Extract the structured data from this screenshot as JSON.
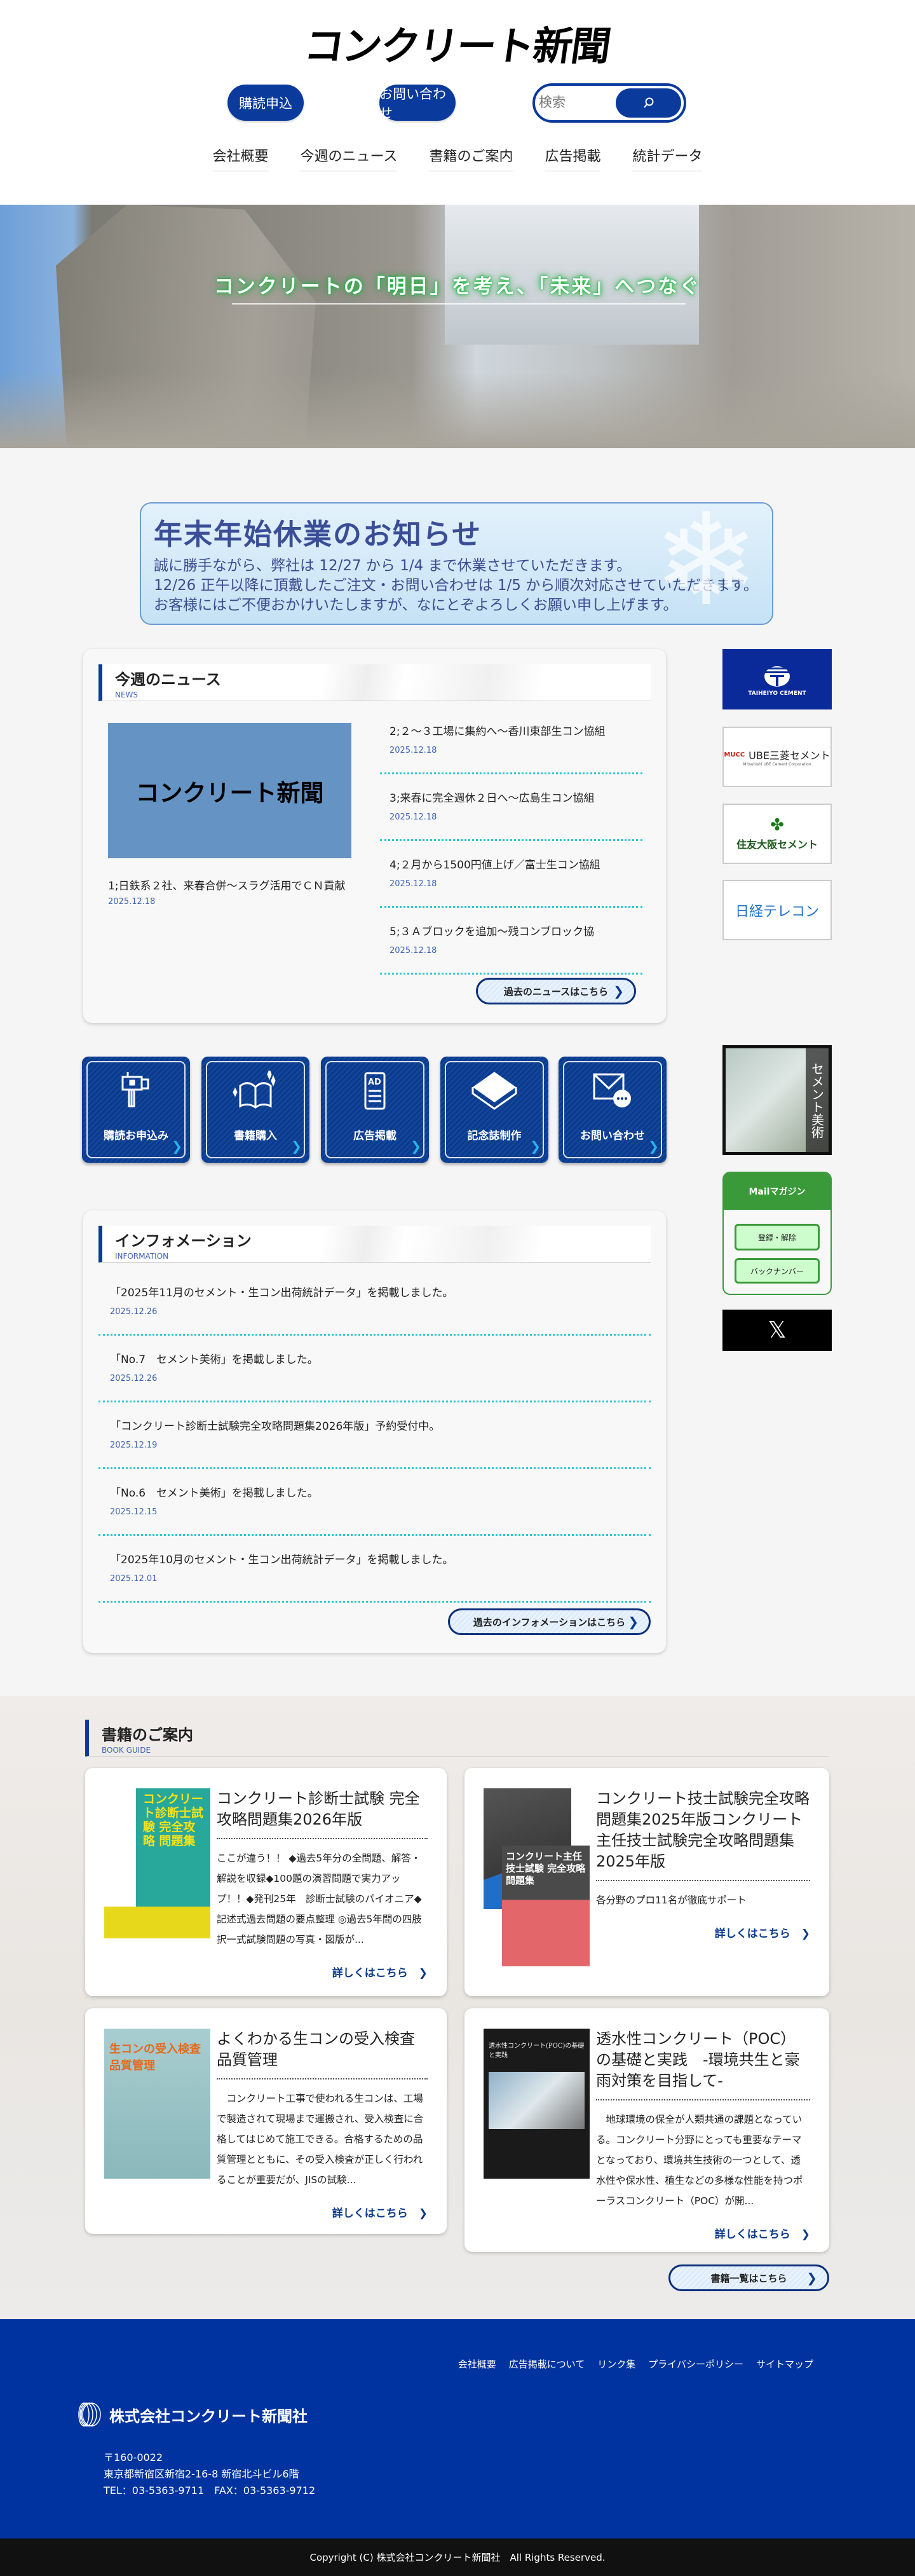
{
  "header": {
    "logo_text": "コンクリート新聞",
    "subscribe_label": "購読申込",
    "contact_label": "お問い合わせ",
    "search_placeholder": "検索",
    "nav": [
      "会社概要",
      "今週のニュース",
      "書籍のご案内",
      "広告掲載",
      "統計データ"
    ]
  },
  "hero": {
    "slogan": "コンクリートの「明日」を考え、「未来」へつなぐ"
  },
  "notice": {
    "title": "年末年始休業のお知らせ",
    "lines": [
      "誠に勝手ながら、弊社は 12/27 から 1/4 まで休業させていただきます。",
      "12/26 正午以降に頂戴したご注文・お問い合わせは 1/5 から順次対応させていただきます。",
      "お客様にはご不便おかけいたしますが、なにとぞよろしくお願い申し上げます。"
    ]
  },
  "news": {
    "title": "今週のニュース",
    "subtitle": "NEWS",
    "image_text": "コンクリート新聞",
    "featured": {
      "title": "1;日鉄系２社、来春合併～スラグ活用でＣＮ貢献",
      "date": "2025.12.18"
    },
    "items": [
      {
        "title": "2;２～３工場に集約へ～香川東部生コン協組",
        "date": "2025.12.18"
      },
      {
        "title": "3;来春に完全週休２日へ～広島生コン協組",
        "date": "2025.12.18"
      },
      {
        "title": "4;２月から1500円値上げ／富士生コン協組",
        "date": "2025.12.18"
      },
      {
        "title": "5;３Ａブロックを追加～残コンブロック協",
        "date": "2025.12.18"
      }
    ],
    "more_label": "過去のニュースはこちら"
  },
  "sidebar": {
    "banners": [
      {
        "text": "TAIHEIYO CEMENT"
      },
      {
        "text": "UBE三菱セメント",
        "sub": "Mitsubishi UBE Cement Corporation",
        "mark": "MUCC"
      },
      {
        "text": "住友大阪セメント"
      },
      {
        "text": "日経テレコン"
      }
    ],
    "art_label": "セメント美術",
    "mail": {
      "title": "Mailマガジン",
      "register": "登録・解除",
      "backnumber": "バックナンバー"
    },
    "x_label": "𝕏"
  },
  "quick_links": [
    "購読お申込み",
    "書籍購入",
    "広告掲載",
    "記念誌制作",
    "お問い合わせ"
  ],
  "info": {
    "title": "インフォメーション",
    "subtitle": "INFORMATION",
    "items": [
      {
        "title": "「2025年11月のセメント・生コン出荷統計データ」を掲載しました。",
        "date": "2025.12.26"
      },
      {
        "title": "「No.7　セメント美術」を掲載しました。",
        "date": "2025.12.26"
      },
      {
        "title": "「コンクリート診断士試験完全攻略問題集2026年版」予約受付中。",
        "date": "2025.12.19"
      },
      {
        "title": "「No.6　セメント美術」を掲載しました。",
        "date": "2025.12.15"
      },
      {
        "title": "「2025年10月のセメント・生コン出荷統計データ」を掲載しました。",
        "date": "2025.12.01"
      }
    ],
    "more_label": "過去のインフォメーションはこちら"
  },
  "books": {
    "title": "書籍のご案内",
    "subtitle": "BOOK GUIDE",
    "detail_label": "詳しくはこちら",
    "items": [
      {
        "title": "コンクリート診断士試験 完全攻略問題集2026年版",
        "desc": "ここが違う！！ ◆過去5年分の全問題、解答・解説を収録◆100題の演習問題で実力アップ！！◆発刊25年　診断士試験のパイオニア◆記述式過去問題の要点整理 ◎過去5年間の四肢択一式試験問題の写真・図版が...",
        "cover": "コンクリート診断士試験 完全攻略 問題集"
      },
      {
        "title": "コンクリート技士試験完全攻略問題集2025年版コンクリート主任技士試験完全攻略問題集2025年版",
        "desc": "各分野のプロ11名が徹底サポート",
        "cover": "コンクリート主任技士試験 完全攻略問題集"
      },
      {
        "title": "よくわかる生コンの受入検査品質管理",
        "desc": "　コンクリート工事で使われる生コンは、工場で製造されて現場まで運搬され、受入検査に合格してはじめて施工できる。合格するための品質管理とともに、その受入検査が正しく行われることが重要だが、JISの試験...",
        "cover": "生コンの受入検査 品質管理"
      },
      {
        "title": "透水性コンクリート（POC）の基礎と実践　-環境共生と豪雨対策を目指して-",
        "desc": "　地球環境の保全が人類共通の課題となっている。コンクリート分野にとっても重要なテーマとなっており、環境共生技術の一つとして、透水性や保水性、植生などの多様な性能を持つポーラスコンクリート（POC）が開...",
        "cover": "透水性コンクリート(POC)の基礎と実践"
      }
    ],
    "list_label": "書籍一覧はこちら"
  },
  "footer": {
    "links": [
      "会社概要",
      "広告掲載について",
      "リンク集",
      "プライバシーポリシー",
      "サイトマップ"
    ],
    "company": "株式会社コンクリート新聞社",
    "zip": "〒160-0022",
    "address": "東京都新宿区新宿2-16-8 新宿北斗ビル6階",
    "tel_fax": "TEL：03-5363-9711　FAX：03-5363-9712",
    "copyright": "Copyright (C) 株式会社コンクリート新聞社　All Rights Reserved."
  },
  "colors": {
    "primary": "#0a3a9c",
    "footer": "#0033a0",
    "accent_dotted": "#2ec6cf",
    "date": "#3f64b5",
    "mail_green": "#3a9a3a"
  }
}
